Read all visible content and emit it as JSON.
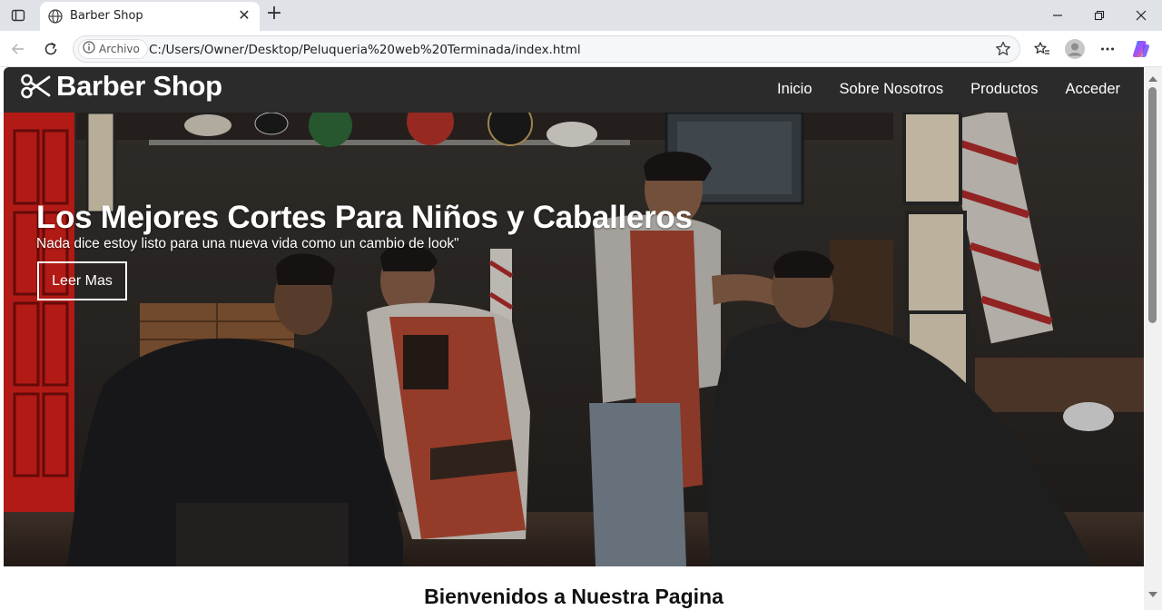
{
  "browser": {
    "tab_title": "Barber Shop",
    "site_chip_label": "Archivo",
    "url": "C:/Users/Owner/Desktop/Peluqueria%20web%20Terminada/index.html",
    "icons": {
      "tab_actions": "tab-actions-icon",
      "favicon": "globe-icon",
      "tab_close": "close-icon",
      "new_tab": "plus-icon",
      "back": "arrow-left-icon",
      "reload": "reload-icon",
      "site_info": "info-icon",
      "favorite": "star-icon",
      "favorites_list": "favorites-icon",
      "profile": "avatar-icon",
      "more": "more-icon",
      "copilot": "copilot-icon"
    }
  },
  "site": {
    "brand": "Barber Shop",
    "nav": [
      {
        "label": "Inicio"
      },
      {
        "label": "Sobre Nosotros"
      },
      {
        "label": "Productos"
      },
      {
        "label": "Acceder"
      }
    ],
    "hero": {
      "title": "Los Mejores Cortes Para Niños y Caballeros",
      "subtitle": "Nada dice estoy listo para una nueva vida como un cambio de look\"",
      "button_label": "Leer Mas"
    },
    "welcome_heading": "Bienvenidos a Nuestra Pagina"
  },
  "colors": {
    "nav_bar": "#2b2b2b",
    "browser_frame": "#dfe3e8",
    "hero_text": "#ffffff"
  }
}
